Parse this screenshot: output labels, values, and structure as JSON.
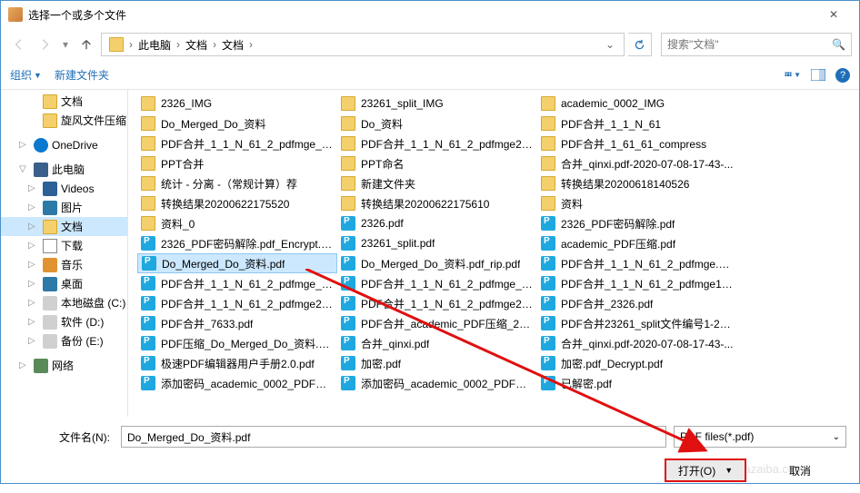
{
  "titlebar": {
    "title": "选择一个或多个文件"
  },
  "breadcrumb": {
    "seg1": "此电脑",
    "seg2": "文档",
    "seg3": "文档"
  },
  "search": {
    "placeholder": "搜索\"文档\""
  },
  "toolbar": {
    "organize": "组织",
    "newfolder": "新建文件夹"
  },
  "sidebar": [
    {
      "label": "文档",
      "icon": "i-folder",
      "lvl": "l2",
      "exp": ""
    },
    {
      "label": "旋风文件压缩",
      "icon": "i-folder",
      "lvl": "l2",
      "exp": ""
    },
    {
      "label": "OneDrive",
      "icon": "i-onedrive",
      "lvl": "l1",
      "exp": "▷",
      "gap": true
    },
    {
      "label": "此电脑",
      "icon": "i-pc",
      "lvl": "l1",
      "exp": "▽",
      "gap": true
    },
    {
      "label": "Videos",
      "icon": "i-videos",
      "lvl": "l2",
      "exp": "▷"
    },
    {
      "label": "图片",
      "icon": "i-pictures",
      "lvl": "l2",
      "exp": "▷"
    },
    {
      "label": "文档",
      "icon": "i-folder",
      "lvl": "l2",
      "exp": "▷",
      "sel": true
    },
    {
      "label": "下载",
      "icon": "i-downloads",
      "lvl": "l2",
      "exp": "▷"
    },
    {
      "label": "音乐",
      "icon": "i-music",
      "lvl": "l2",
      "exp": "▷"
    },
    {
      "label": "桌面",
      "icon": "i-desktop",
      "lvl": "l2",
      "exp": "▷"
    },
    {
      "label": "本地磁盘 (C:)",
      "icon": "i-disk",
      "lvl": "l2",
      "exp": "▷"
    },
    {
      "label": "软件 (D:)",
      "icon": "i-disk",
      "lvl": "l2",
      "exp": "▷"
    },
    {
      "label": "备份 (E:)",
      "icon": "i-disk",
      "lvl": "l2",
      "exp": "▷"
    },
    {
      "label": "网络",
      "icon": "i-network",
      "lvl": "l1",
      "exp": "▷",
      "gap": true
    }
  ],
  "columns": [
    [
      {
        "name": "2326_IMG",
        "type": "folder"
      },
      {
        "name": "Do_Merged_Do_资料",
        "type": "folder"
      },
      {
        "name": "PDF合并_1_1_N_61_2_pdfmge_压缩",
        "type": "folder"
      },
      {
        "name": "PPT合并",
        "type": "folder"
      },
      {
        "name": "统计 - 分离 -（常规计算）荐",
        "type": "folder"
      },
      {
        "name": "转换结果20200622175520",
        "type": "folder"
      },
      {
        "name": "资料_0",
        "type": "folder"
      },
      {
        "name": "2326_PDF密码解除.pdf_Encrypt.pdf",
        "type": "pdf"
      },
      {
        "name": "Do_Merged_Do_资料.pdf",
        "type": "pdf",
        "sel": true
      },
      {
        "name": "PDF合并_1_1_N_61_2_pdfmge_0_s...",
        "type": "pdf"
      },
      {
        "name": "PDF合并_1_1_N_61_2_pdfmge2_sp...",
        "type": "pdf"
      },
      {
        "name": "PDF合并_7633.pdf",
        "type": "pdf"
      },
      {
        "name": "PDF压缩_Do_Merged_Do_资料.pd...",
        "type": "pdf"
      },
      {
        "name": "极速PDF编辑器用户手册2.0.pdf",
        "type": "pdf"
      },
      {
        "name": "添加密码_academic_0002_PDF压缩...",
        "type": "pdf"
      }
    ],
    [
      {
        "name": "23261_split_IMG",
        "type": "folder"
      },
      {
        "name": "Do_资料",
        "type": "folder"
      },
      {
        "name": "PDF合并_1_1_N_61_2_pdfmge2_sp...",
        "type": "folder"
      },
      {
        "name": "PPT命名",
        "type": "folder"
      },
      {
        "name": "新建文件夹",
        "type": "folder"
      },
      {
        "name": "转换结果20200622175610",
        "type": "folder"
      },
      {
        "name": "2326.pdf",
        "type": "pdf"
      },
      {
        "name": "23261_split.pdf",
        "type": "pdf"
      },
      {
        "name": "Do_Merged_Do_资料.pdf_rip.pdf",
        "type": "pdf"
      },
      {
        "name": "PDF合并_1_1_N_61_2_pdfmge_压...",
        "type": "pdf"
      },
      {
        "name": "PDF合并_1_1_N_61_2_pdfmge2_sp...",
        "type": "pdf"
      },
      {
        "name": "PDF合并_academic_PDF压缩_2326...",
        "type": "pdf"
      },
      {
        "name": "合并_qinxi.pdf",
        "type": "pdf"
      },
      {
        "name": "加密.pdf",
        "type": "pdf"
      },
      {
        "name": "添加密码_academic_0002_PDF压缩...",
        "type": "pdf"
      }
    ],
    [
      {
        "name": "academic_0002_IMG",
        "type": "folder"
      },
      {
        "name": "PDF合并_1_1_N_61",
        "type": "folder"
      },
      {
        "name": "PDF合并_1_61_61_compress",
        "type": "folder"
      },
      {
        "name": "合并_qinxi.pdf-2020-07-08-17-43-...",
        "type": "folder"
      },
      {
        "name": "转换结果20200618140526",
        "type": "folder"
      },
      {
        "name": "资料",
        "type": "folder"
      },
      {
        "name": "2326_PDF密码解除.pdf",
        "type": "pdf"
      },
      {
        "name": "academic_PDF压缩.pdf",
        "type": "pdf"
      },
      {
        "name": "PDF合并_1_1_N_61_2_pdfmge.pdf",
        "type": "pdf"
      },
      {
        "name": "PDF合并_1_1_N_61_2_pdfmge1_sp...",
        "type": "pdf"
      },
      {
        "name": "PDF合并_2326.pdf",
        "type": "pdf"
      },
      {
        "name": "PDF合并23261_split文件编号1-2.pdf",
        "type": "pdf"
      },
      {
        "name": "合并_qinxi.pdf-2020-07-08-17-43-...",
        "type": "pdf"
      },
      {
        "name": "加密.pdf_Decrypt.pdf",
        "type": "pdf"
      },
      {
        "name": "已解密.pdf",
        "type": "pdf"
      }
    ]
  ],
  "bottom": {
    "label": "文件名(N):",
    "value": "Do_Merged_Do_资料.pdf",
    "filter": "PDF files(*.pdf)"
  },
  "buttons": {
    "open": "打开(O)",
    "cancel": "取消"
  },
  "watermark": "www.xiazaiba.com"
}
